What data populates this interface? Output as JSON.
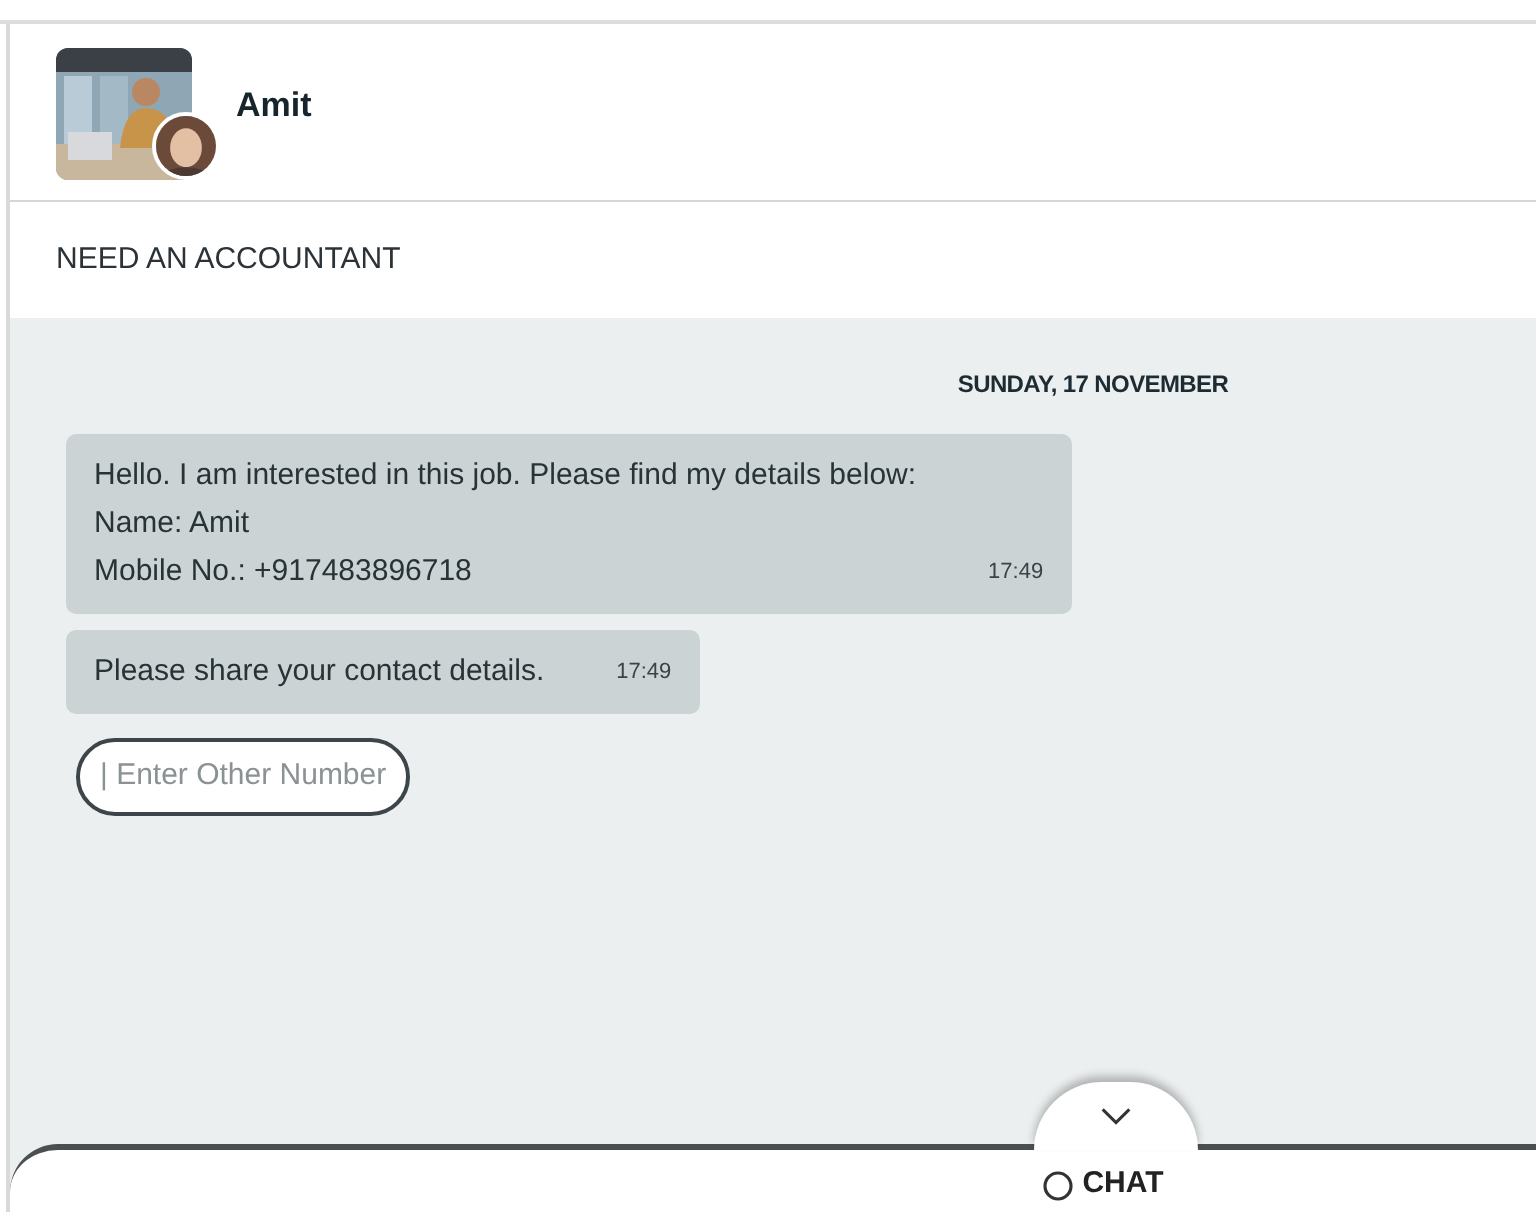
{
  "header": {
    "name": "Amit"
  },
  "subject": "NEED AN ACCOUNTANT",
  "date": "SUNDAY, 17 NOVEMBER",
  "messages": [
    {
      "lines": [
        "Hello. I am interested in this job. Please find my details below:",
        "Name: Amit",
        "Mobile No.: +917483896718"
      ],
      "time": "17:49"
    },
    {
      "lines": [
        "Please share your contact details."
      ],
      "time": "17:49"
    }
  ],
  "quick_reply": "| Enter Other Number",
  "chat_panel": {
    "label": "CHAT",
    "expanded": false
  }
}
